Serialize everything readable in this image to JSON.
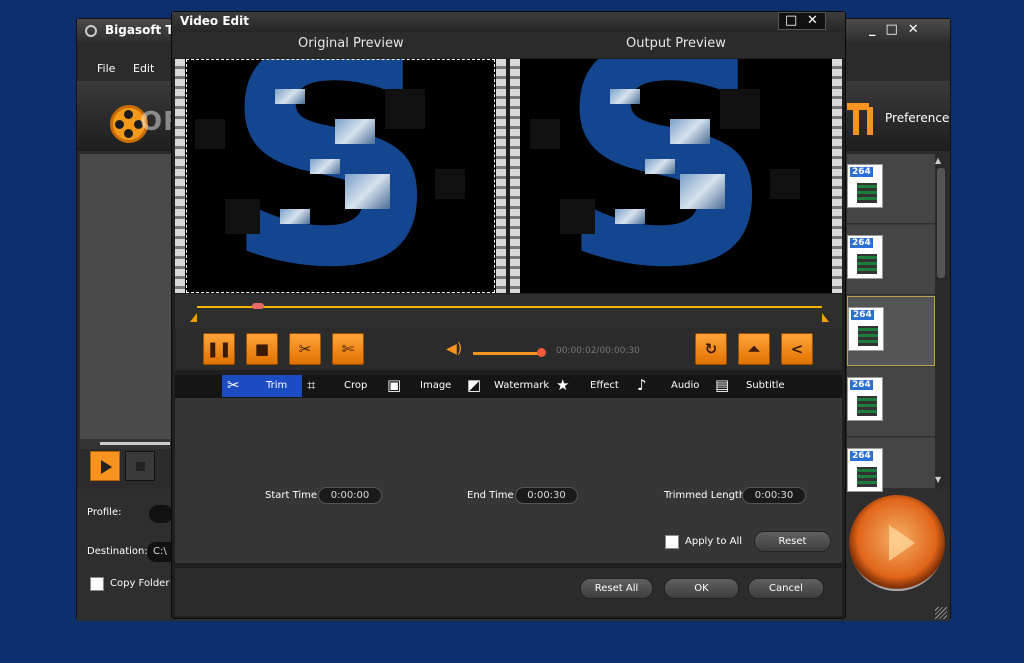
{
  "main_window": {
    "title": "Bigasoft To",
    "menu": {
      "file": "File",
      "edit": "Edit"
    },
    "watermark": "OFTPEDIA",
    "preference_label": "Preference",
    "profile_label": "Profile:",
    "destination_label": "Destination:",
    "destination_value": "C:\\",
    "copy_folder_label": "Copy Folder S",
    "file_badge": "264",
    "window_buttons": "_□✕"
  },
  "dialog": {
    "title": "Video Edit",
    "original_preview": "Original Preview",
    "output_preview": "Output Preview",
    "time_display": "00:00:02/00:00:30",
    "tabs": [
      {
        "label": "Trim",
        "icon": "scissors-icon"
      },
      {
        "label": "Crop",
        "icon": "crop-icon"
      },
      {
        "label": "Image",
        "icon": "image-icon"
      },
      {
        "label": "Watermark",
        "icon": "watermark-icon"
      },
      {
        "label": "Effect",
        "icon": "star-icon"
      },
      {
        "label": "Audio",
        "icon": "music-note-icon"
      },
      {
        "label": "Subtitle",
        "icon": "subtitle-icon"
      }
    ],
    "trim": {
      "start_label": "Start Time",
      "start_value": "0:00:00",
      "end_label": "End Time",
      "end_value": "0:00:30",
      "trimmed_label": "Trimmed Length",
      "trimmed_value": "0:00:30",
      "apply_all": "Apply to All",
      "reset": "Reset"
    },
    "buttons": {
      "reset_all": "Reset All",
      "ok": "OK",
      "cancel": "Cancel"
    },
    "accent_color": "#f7931e",
    "tab_active_color": "#1d4bc0"
  }
}
